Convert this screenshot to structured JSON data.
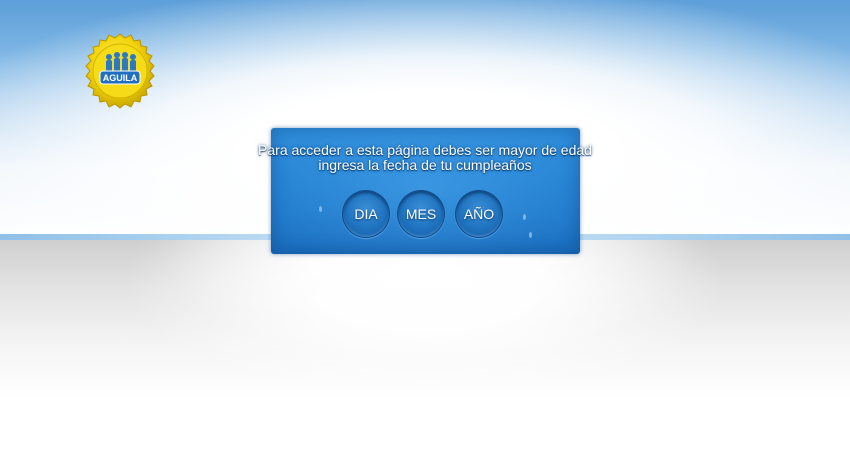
{
  "logo": {
    "brand_text": "AGUILA",
    "icon": "bottle-cap-logo",
    "cap_color": "#f5d90a",
    "label_color": "#1f6fc0"
  },
  "age_gate": {
    "line1": "Para acceder a esta página debes ser mayor de edad",
    "line2": "ingresa la fecha de tu cumpleaños",
    "panel_color": "#1f7ecf",
    "buttons": {
      "day": "DIA",
      "month": "MES",
      "year": "AÑO"
    }
  }
}
